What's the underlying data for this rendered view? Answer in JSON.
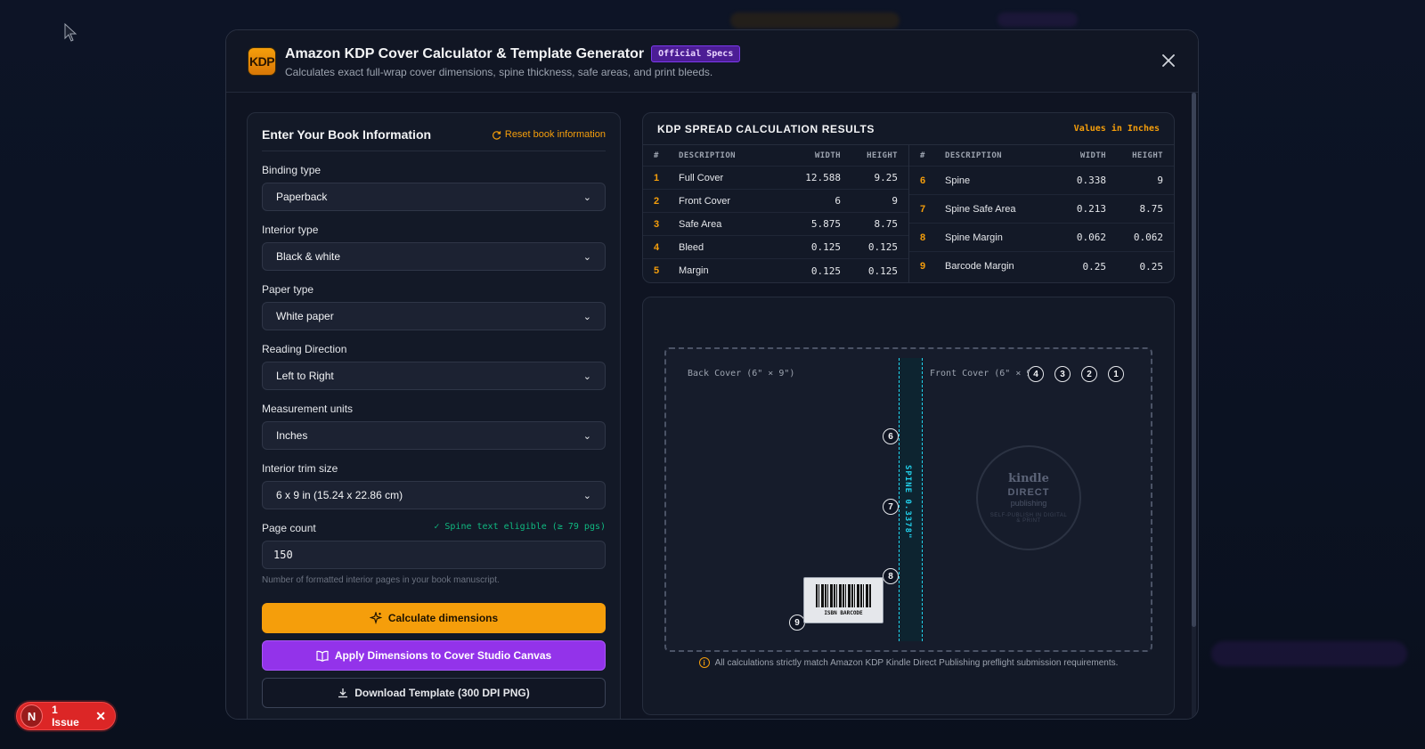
{
  "modal": {
    "logo_text": "KDP",
    "title": "Amazon KDP Cover Calculator & Template Generator",
    "badge": "Official Specs",
    "subtitle": "Calculates exact full-wrap cover dimensions, spine thickness, safe areas, and print bleeds.",
    "close_icon": "close-icon"
  },
  "form": {
    "title": "Enter Your Book Information",
    "reset_label": "Reset book information",
    "binding_label": "Binding type",
    "binding_value": "Paperback",
    "interior_label": "Interior type",
    "interior_value": "Black & white",
    "paper_label": "Paper type",
    "paper_value": "White paper",
    "direction_label": "Reading Direction",
    "direction_value": "Left to Right",
    "units_label": "Measurement units",
    "units_value": "Inches",
    "trim_label": "Interior trim size",
    "trim_value": "6 x 9 in (15.24 x 22.86 cm)",
    "pages_label": "Page count",
    "pages_eligible": "✓ Spine text eligible (≥ 79 pgs)",
    "pages_value": "150",
    "pages_hint": "Number of formatted interior pages in your book manuscript.",
    "calc_label": "Calculate dimensions",
    "apply_label": "Apply Dimensions to Cover Studio Canvas",
    "download_label": "Download Template (300 DPI PNG)"
  },
  "results": {
    "title": "KDP SPREAD CALCULATION RESULTS",
    "units": "Values in Inches",
    "headers": {
      "num": "#",
      "desc": "DESCRIPTION",
      "width": "WIDTH",
      "height": "HEIGHT"
    },
    "left": [
      {
        "num": "1",
        "desc": "Full Cover",
        "width": "12.588",
        "height": "9.25"
      },
      {
        "num": "2",
        "desc": "Front Cover",
        "width": "6",
        "height": "9"
      },
      {
        "num": "3",
        "desc": "Safe Area",
        "width": "5.875",
        "height": "8.75"
      },
      {
        "num": "4",
        "desc": "Bleed",
        "width": "0.125",
        "height": "0.125"
      },
      {
        "num": "5",
        "desc": "Margin",
        "width": "0.125",
        "height": "0.125"
      }
    ],
    "right": [
      {
        "num": "6",
        "desc": "Spine",
        "width": "0.338",
        "height": "9"
      },
      {
        "num": "7",
        "desc": "Spine Safe Area",
        "width": "0.213",
        "height": "8.75"
      },
      {
        "num": "8",
        "desc": "Spine Margin",
        "width": "0.062",
        "height": "0.062"
      },
      {
        "num": "9",
        "desc": "Barcode Margin",
        "width": "0.25",
        "height": "0.25"
      }
    ]
  },
  "preview": {
    "back_label": "Back Cover (6\" × 9\")",
    "front_label": "Front Cover (6\" × 9\")",
    "spine_label": "SPINE 0.3378\"",
    "markers": [
      "1",
      "2",
      "3",
      "4",
      "6",
      "7",
      "8",
      "9"
    ],
    "logo_line1": "kindle",
    "logo_line2": "DIRECT",
    "logo_line3": "publishing",
    "logo_line4": "SELF-PUBLISH IN DIGITAL & PRINT",
    "barcode_label": "ISBN BARCODE",
    "note": "All calculations strictly match Amazon KDP Kindle Direct Publishing preflight submission requirements."
  },
  "issue_badge": {
    "initial": "N",
    "label": "1 Issue"
  },
  "colors": {
    "accent": "#f59e0b",
    "purple": "#9333ea",
    "spine": "#22d3ee",
    "issue": "#dc2626"
  }
}
